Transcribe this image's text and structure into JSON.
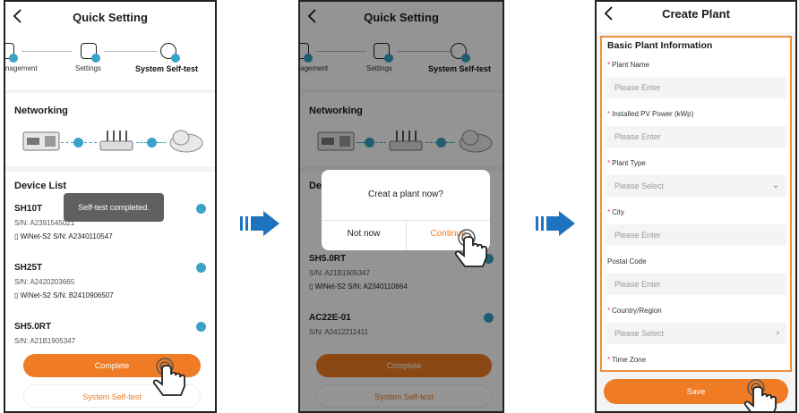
{
  "screen1": {
    "title": "Quick Setting",
    "steps": [
      "nagement",
      "Settings",
      "System Self-test"
    ],
    "networking_label": "Networking",
    "device_list_label": "Device List",
    "toast": "Self-test completed.",
    "devices": [
      {
        "name": "SH10T",
        "sn": "S/N: A2391545021",
        "wifi": "WiNet-S2  S/N: A2340110547"
      },
      {
        "name": "SH25T",
        "sn": "S/N: A2420203665",
        "wifi": "WiNet-S2  S/N: B2410906507"
      },
      {
        "name": "SH5.0RT",
        "sn": "S/N: A21B1905347"
      }
    ],
    "complete_label": "Complete",
    "self_test_label": "System Self-test"
  },
  "screen2": {
    "title": "Quick Setting",
    "steps": [
      "agement",
      "Settings",
      "System Self-test"
    ],
    "networking_label": "Networking",
    "device_list_label": "De",
    "devices": [
      {
        "name": "SH5.0RT",
        "sn": "S/N: A21B1905347",
        "wifi": "WiNet-S2  S/N: A2340110664"
      },
      {
        "name": "AC22E-01",
        "sn": "S/N: A2412211411"
      }
    ],
    "dialog_question": "Creat a plant now?",
    "dialog_cancel": "Not now",
    "dialog_confirm": "Continue",
    "complete_label": "Complete",
    "self_test_label": "System Self-test"
  },
  "screen3": {
    "title": "Create Plant",
    "section": "Basic Plant Information",
    "fields": [
      {
        "label": "Plant Name",
        "placeholder": "Please Enter"
      },
      {
        "label": "Installed PV Power (kWp)",
        "placeholder": "Please Enter"
      },
      {
        "label": "Plant Type",
        "placeholder": "Please Select"
      },
      {
        "label": "City",
        "placeholder": "Please Enter"
      },
      {
        "label": "Postal Code",
        "placeholder": "Please Enter"
      },
      {
        "label": "Country/Region",
        "placeholder": "Please Select"
      },
      {
        "label": "Time Zone"
      }
    ],
    "save_label": "Save"
  },
  "colors": {
    "accent": "#ef7b24",
    "check": "#3aa3c7",
    "arrow": "#1e73be"
  }
}
